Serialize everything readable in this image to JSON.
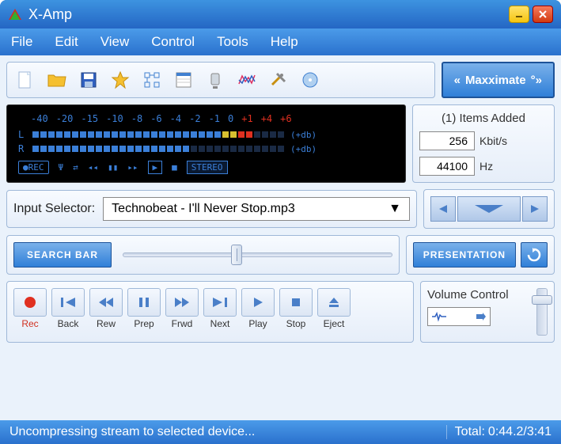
{
  "window": {
    "title": "X-Amp"
  },
  "menu": {
    "items": [
      "File",
      "Edit",
      "View",
      "Control",
      "Tools",
      "Help"
    ]
  },
  "toolbar": {
    "maxximate_label": "Maxximate"
  },
  "vu": {
    "scale": [
      "-40",
      "-20",
      "-15",
      "-10",
      "-8",
      "-6",
      "-4",
      "-2",
      "-1",
      "0",
      "+1",
      "+4",
      "+6"
    ],
    "left_label": "L",
    "right_label": "R",
    "db_label": "(+db)",
    "rec_label": "●REC",
    "stereo_label": "STEREO"
  },
  "info": {
    "title": "(1) Items Added",
    "bitrate": "256",
    "bitrate_unit": "Kbit/s",
    "samplerate": "44100",
    "samplerate_unit": "Hz"
  },
  "selector": {
    "label": "Input Selector:",
    "value": "Technobeat - I'll Never Stop.mp3"
  },
  "search": {
    "label": "SEARCH BAR"
  },
  "presentation": {
    "label": "PRESENTATION"
  },
  "transport": {
    "items": [
      "Rec",
      "Back",
      "Rew",
      "Prep",
      "Frwd",
      "Next",
      "Play",
      "Stop",
      "Eject"
    ]
  },
  "volume": {
    "title": "Volume Control"
  },
  "status": {
    "message": "Uncompressing stream to selected device...",
    "total_label": "Total:",
    "total_value": "0:44.2/3:41"
  }
}
